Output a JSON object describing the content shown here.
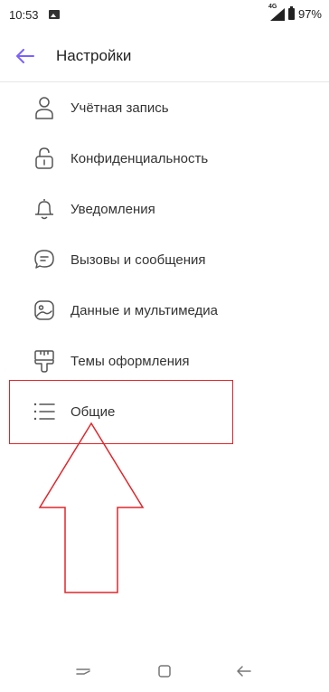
{
  "status_bar": {
    "time": "10:53",
    "network": "4G",
    "battery": "97%"
  },
  "app_bar": {
    "title": "Настройки"
  },
  "settings": {
    "items": [
      {
        "label": "Учётная запись",
        "icon": "person-icon"
      },
      {
        "label": "Конфиденциальность",
        "icon": "lock-icon"
      },
      {
        "label": "Уведомления",
        "icon": "bell-icon"
      },
      {
        "label": "Вызовы и сообщения",
        "icon": "chat-icon"
      },
      {
        "label": "Данные и мультимедиа",
        "icon": "media-icon"
      },
      {
        "label": "Темы оформления",
        "icon": "brush-icon"
      },
      {
        "label": "Общие",
        "icon": "list-icon"
      }
    ]
  },
  "colors": {
    "accent": "#7b61ff",
    "annotation": "#e0262b",
    "icon": "#555555"
  }
}
